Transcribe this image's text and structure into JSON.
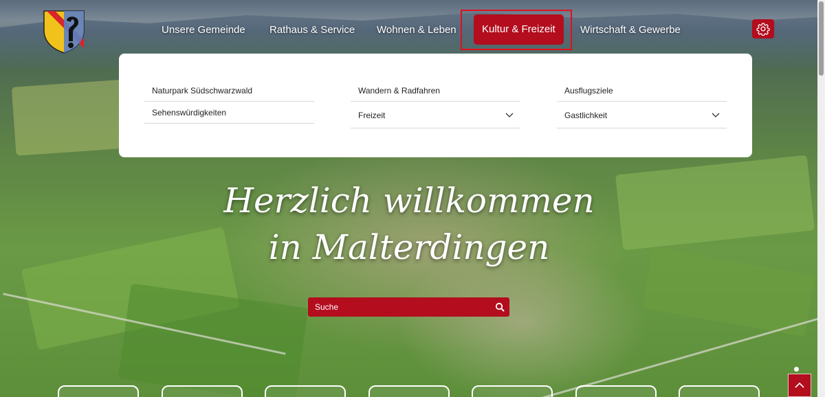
{
  "nav": {
    "items": [
      {
        "label": "Unsere Gemeinde"
      },
      {
        "label": "Rathaus & Service"
      },
      {
        "label": "Wohnen & Leben"
      },
      {
        "label": "Kultur & Freizeit"
      },
      {
        "label": "Wirtschaft & Gewerbe"
      }
    ],
    "settings_icon": "gear-icon"
  },
  "dropdown": {
    "col1": [
      "Naturpark Südschwarzwald",
      "Sehenswürdigkeiten"
    ],
    "col2": [
      "Wandern & Radfahren",
      "Freizeit"
    ],
    "col3": [
      "Ausflugsziele",
      "Gastlichkeit"
    ]
  },
  "hero": {
    "line1": "Herzlich willkommen",
    "line2": "in Malterdingen"
  },
  "search": {
    "placeholder": "Suche",
    "icon": "search-icon"
  },
  "colors": {
    "accent": "#b30d1e",
    "highlight": "#e0101e"
  }
}
